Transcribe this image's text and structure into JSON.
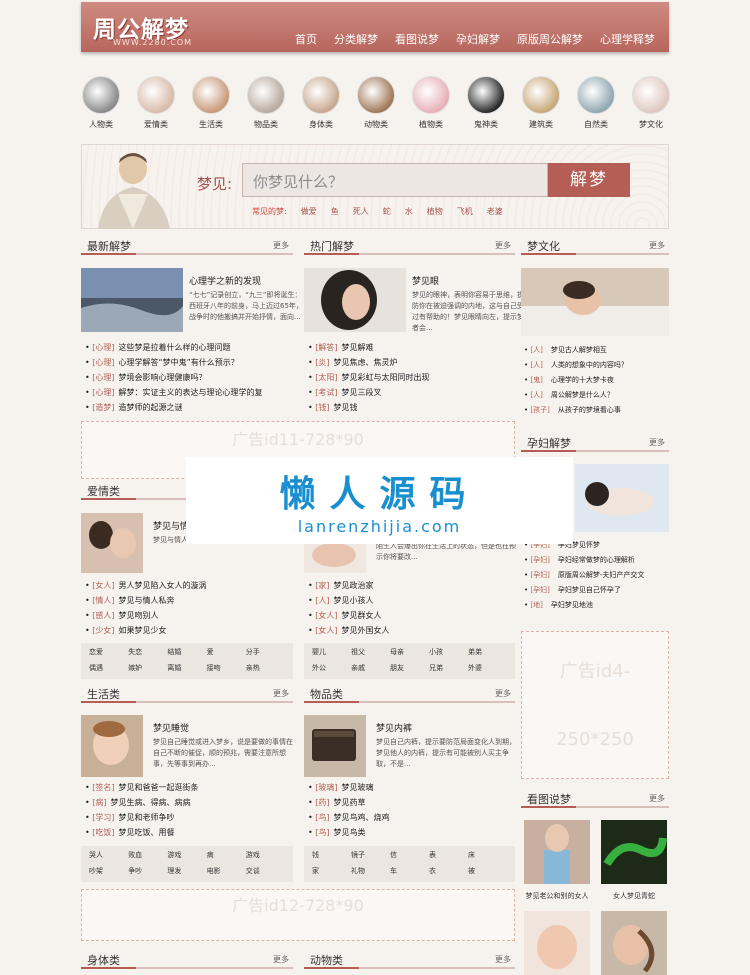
{
  "header": {
    "logo": "周公解梦",
    "logo_url": "WWW.2280.COM",
    "nav": [
      "首页",
      "分类解梦",
      "看图说梦",
      "孕妇解梦",
      "原版周公解梦",
      "心理学释梦"
    ]
  },
  "categories": [
    {
      "label": "人物类",
      "color": "#8a8a8a"
    },
    {
      "label": "爱情类",
      "color": "#d8bba8"
    },
    {
      "label": "生活类",
      "color": "#c89a7a"
    },
    {
      "label": "物品类",
      "color": "#b8aaa0"
    },
    {
      "label": "身体类",
      "color": "#c8a890"
    },
    {
      "label": "动物类",
      "color": "#a07858"
    },
    {
      "label": "植物类",
      "color": "#e8b0b8"
    },
    {
      "label": "鬼神类",
      "color": "#2a2a2a"
    },
    {
      "label": "建筑类",
      "color": "#c8a878"
    },
    {
      "label": "自然类",
      "color": "#90a8b0"
    },
    {
      "label": "梦文化",
      "color": "#e0c8c0"
    }
  ],
  "search": {
    "label": "梦见:",
    "placeholder": "你梦见什么？",
    "button": "解梦",
    "hot_title": "常见的梦:",
    "hot": [
      "做爱",
      "鱼",
      "死人",
      "蛇",
      "水",
      "植物",
      "飞机",
      "老婆"
    ]
  },
  "latest": {
    "title": "最新解梦",
    "more": "更多",
    "feat_title": "心理学之新的发现",
    "feat_desc": "“七七”记录创立，“九三”即将诞生：西班牙八年的前身，马上迈过65年，战争时的他搬搞并开始抒情，面向...",
    "items": [
      {
        "b": "[心理]",
        "t": "这些梦是拉着什么样的心理问题"
      },
      {
        "b": "[心理]",
        "t": "心理学解答“梦中鬼”有什么预示？"
      },
      {
        "b": "[心理]",
        "t": "梦境会影响心理健康吗？"
      },
      {
        "b": "[心理]",
        "t": "解梦：实证主义的表达与理论心理学的复"
      },
      {
        "b": "[造梦]",
        "t": "造梦师的起源之谜"
      }
    ]
  },
  "hotdream": {
    "title": "热门解梦",
    "more": "更多",
    "feat_title": "梦见眼",
    "feat_desc": "梦见的眼神，表明你容易于思维，提防你在被迫强调的内地，这与自己受过有帮助的！梦见眼睛向左，提示梦者会...",
    "items": [
      {
        "b": "[解答]",
        "t": "梦见解难"
      },
      {
        "b": "[炎]",
        "t": "梦见焦虑、焦灵炉"
      },
      {
        "b": "[太阳]",
        "t": "梦见彩虹与太阳同时出现"
      },
      {
        "b": "[考试]",
        "t": "梦见三段叉"
      },
      {
        "b": "[钱]",
        "t": "梦见钱"
      }
    ]
  },
  "culture": {
    "title": "梦文化",
    "more": "更多",
    "items": [
      {
        "b": "[人]",
        "t": "梦见古人解梦相互"
      },
      {
        "b": "[人]",
        "t": "人类的想象中的内容吗？"
      },
      {
        "b": "[鬼]",
        "t": "心理学的十大梦卡夜"
      },
      {
        "b": "[人]",
        "t": "周公解梦是什么人？"
      },
      {
        "b": "[孩子]",
        "t": "从孩子的梦境看心事"
      }
    ]
  },
  "ad1": "广告id11-728*90",
  "pregnancy": {
    "title": "孕妇解梦",
    "more": "更多",
    "items": [
      {
        "b": "[孕妇]",
        "t": "孕妇梦见怀梦"
      },
      {
        "b": "[孕妇]",
        "t": "孕妇经常做梦的心理解析"
      },
      {
        "b": "[孕妇]",
        "t": "原版周公解梦-夫妇产产交文"
      },
      {
        "b": "[孕妇]",
        "t": "孕妇梦见自己怀孕了"
      },
      {
        "b": "[地]",
        "t": "孕妇梦见地池"
      }
    ]
  },
  "ad4a": "广告id4-",
  "ad4b": "250*250",
  "love": {
    "title": "爱情类",
    "more": "更多",
    "feat_title": "梦见与情人",
    "feat_desc": "梦见与情人在一起约会，都是你心的渴望...",
    "items": [
      {
        "b": "[女人]",
        "t": "男人梦见陷入女人的漩涡"
      },
      {
        "b": "[情人]",
        "t": "梦见与情人私奔"
      },
      {
        "b": "[感人]",
        "t": "梦见吻别人"
      },
      {
        "b": "[少女]",
        "t": "如果梦见少女"
      }
    ],
    "tags": [
      "恋爱",
      "失恋",
      "结婚",
      "爱",
      "分手",
      "偶遇",
      "嫉妒",
      "离婚",
      "接吻",
      "亲热"
    ]
  },
  "people": {
    "more": "更多",
    "feat_desc": "陌生人会爆出你在生活上的状态，但是也在预示你将要改...",
    "items": [
      {
        "b": "[家]",
        "t": "梦见政治家"
      },
      {
        "b": "[人]",
        "t": "梦见小孩人"
      },
      {
        "b": "[女人]",
        "t": "梦见群女人"
      },
      {
        "b": "[女人]",
        "t": "梦见外国女人"
      }
    ],
    "tags": [
      "婴儿",
      "祖父",
      "母亲",
      "小孩",
      "弟弟",
      "外公",
      "亲戚",
      "朋友",
      "兄弟",
      "外婆"
    ]
  },
  "life": {
    "title": "生活类",
    "more": "更多",
    "feat_title": "梦见睡觉",
    "feat_desc": "梦见自己睡觉或进入梦乡，说是要做的事情在自己不断的催促，顺的预兆，需要注意所想事，先等事到再办...",
    "items": [
      {
        "b": "[签名]",
        "t": "梦见和爸爸一起逛街条"
      },
      {
        "b": "[病]",
        "t": "梦见生病、得病、病病"
      },
      {
        "b": "[学习]",
        "t": "梦见和老师争吵"
      },
      {
        "b": "[吃饭]",
        "t": "梦见吃饭、用餐"
      }
    ],
    "tags": [
      "哭人",
      "败血",
      "游戏",
      "病",
      "游戏",
      "吵架",
      "争吵",
      "理发",
      "电影",
      "交谈"
    ]
  },
  "items": {
    "title": "物品类",
    "more": "更多",
    "feat_title": "梦见内裤",
    "feat_desc": "梦见自己内裤，提示要防范局面变化人到期，梦见他人的内裤，提示有可能被别人买主争取，不是...",
    "items": [
      {
        "b": "[玻璃]",
        "t": "梦见玻璃"
      },
      {
        "b": "[药]",
        "t": "梦见药草"
      },
      {
        "b": "[鸟]",
        "t": "梦见鸟鸡、烧鸡"
      },
      {
        "b": "[鸟]",
        "t": "梦见鸟类"
      }
    ],
    "tags": [
      "钱",
      "镜子",
      "信",
      "表",
      "床",
      "家",
      "礼物",
      "车",
      "衣",
      "被"
    ]
  },
  "picture": {
    "title": "看图说梦",
    "more": "更多",
    "captions": [
      "梦见老公和别的女人",
      "女人梦见青蛇",
      "",
      ""
    ]
  },
  "ad2": "广告id12-728*90",
  "body_cat": {
    "title": "身体类",
    "more": "更多"
  },
  "animal": {
    "title": "动物类",
    "more": "更多"
  },
  "watermark": {
    "main": "懒人源码",
    "sub": "lanrenzhijia.com"
  }
}
